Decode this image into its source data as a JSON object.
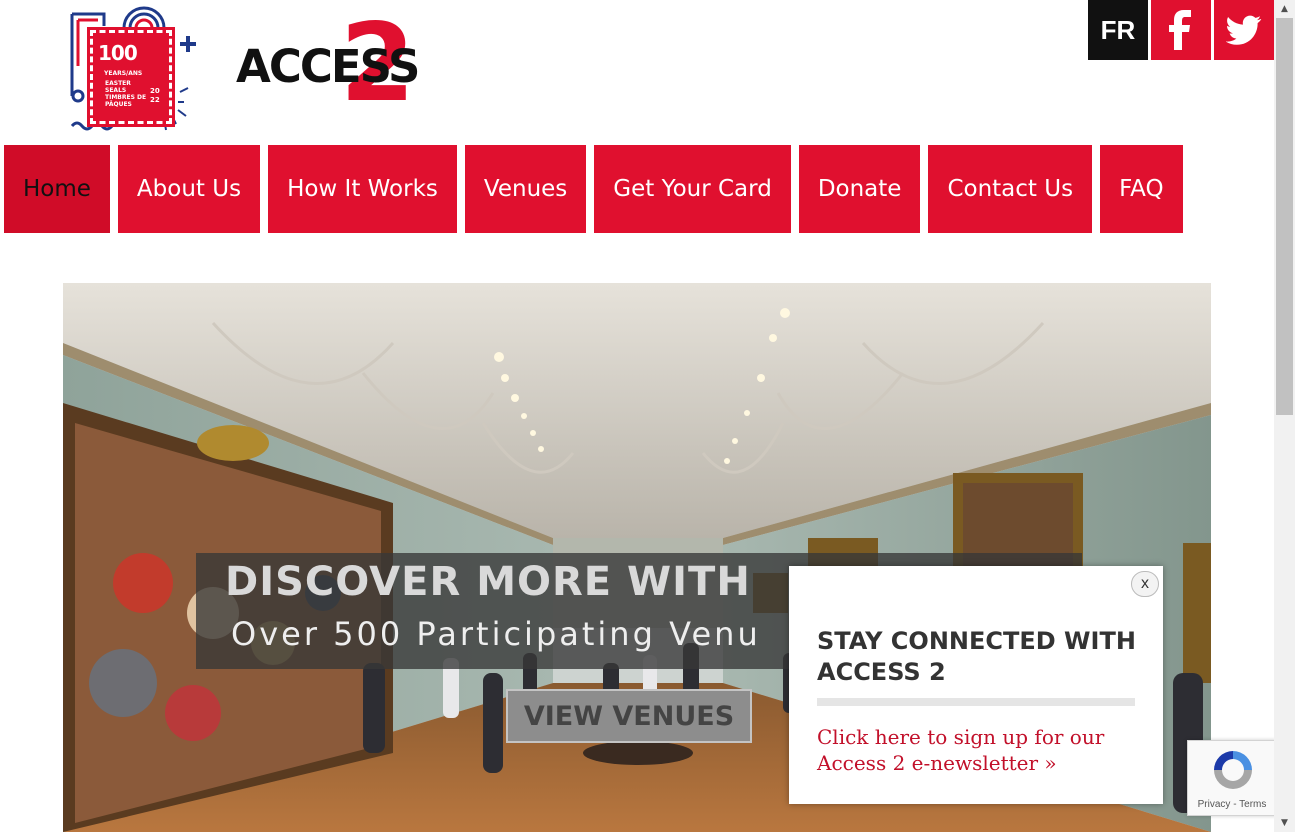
{
  "header": {
    "seal_logo": {
      "number": "100",
      "years": "YEARS/ANS",
      "line1": "EASTER",
      "line2": "SEALS",
      "line3": "TIMBRES DE",
      "line4": "PÂQUES",
      "year_top": "20",
      "year_bottom": "22",
      "brand_red": "#e0102f",
      "brand_blue": "#1f3a8a"
    },
    "access_logo": {
      "word": "ACCESS",
      "number": "2",
      "brand_red": "#e0102f"
    },
    "social": {
      "language_label": "FR",
      "facebook_icon": "facebook-icon",
      "twitter_icon": "twitter-icon"
    }
  },
  "nav": {
    "items": [
      {
        "label": "Home",
        "active": true
      },
      {
        "label": "About Us"
      },
      {
        "label": "How It Works"
      },
      {
        "label": "Venues"
      },
      {
        "label": "Get Your Card"
      },
      {
        "label": "Donate"
      },
      {
        "label": "Contact Us"
      },
      {
        "label": "FAQ"
      }
    ],
    "color": "#e0102f"
  },
  "hero": {
    "title": "DISCOVER MORE WITH",
    "subtitle": "Over 500 Participating Venu",
    "button_label": "VIEW VENUES"
  },
  "popup": {
    "close_label": "x",
    "title": "STAY CONNECTED WITH ACCESS 2",
    "link_text": "Click here to sign up for our Access 2 e-newsletter »"
  },
  "recaptcha": {
    "links": "Privacy - Terms"
  }
}
